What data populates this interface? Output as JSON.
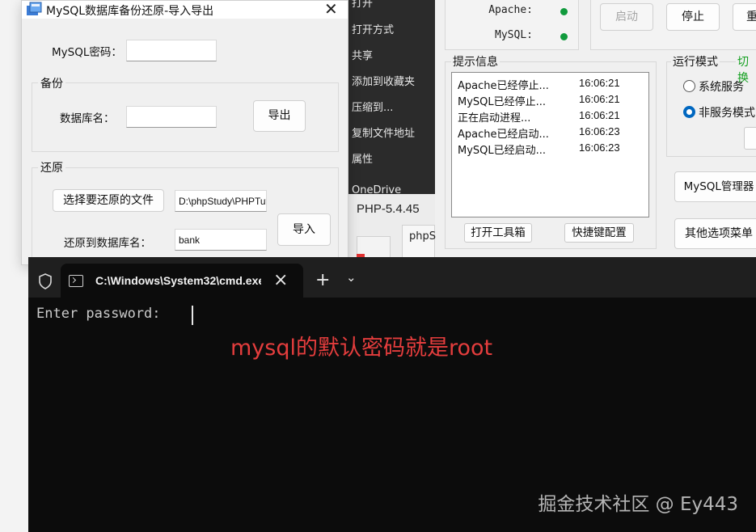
{
  "phpstudy": {
    "services": [
      {
        "name": "Apache:",
        "status": "running"
      },
      {
        "name": "MySQL:",
        "status": "running"
      }
    ],
    "start_label": "启动",
    "stop_label": "停止",
    "restart_label_partial": "重",
    "hint_group_label": "提示信息",
    "hints": [
      {
        "message": "Apache已经停止...",
        "time": "16:06:21"
      },
      {
        "message": "MySQL已经停止...",
        "time": "16:06:21"
      },
      {
        "message": "正在启动进程...",
        "time": "16:06:21"
      },
      {
        "message": "Apache已经启动...",
        "time": "16:06:23"
      },
      {
        "message": "MySQL已经启动...",
        "time": "16:06:23"
      }
    ],
    "toolbox_label": "打开工具箱",
    "hotkey_label": "快捷键配置",
    "mode_group_label": "运行模式",
    "mode_switch_partial": "切换",
    "mode_options": [
      "系统服务",
      "非服务模式"
    ],
    "mode_selected": 1,
    "mysql_manager_label": "MySQL管理器",
    "other_menu_label": "其他选项菜单",
    "status_colors": {
      "running": "#109a3c"
    }
  },
  "context_menu": {
    "items": [
      "打开",
      "打开方式",
      "共享",
      "添加到收藏夹",
      "压缩到...",
      "复制文件地址",
      "属性",
      "OneDrive"
    ]
  },
  "php_panel": {
    "version": "PHP-5.4.45",
    "tab_label": "phpS"
  },
  "dialog": {
    "title": "MySQL数据库备份还原-导入导出",
    "password_label": "MySQL密码：",
    "password_value": "",
    "backup_group": "备份",
    "db_name_label": "数据库名：",
    "db_name_value": "",
    "export_label": "导出",
    "restore_group": "还原",
    "choose_file_label": "选择要还原的文件",
    "file_path": "D:\\phpStudy\\PHPTutorial",
    "restore_to_label": "还原到数据库名：",
    "restore_db": "bank",
    "import_label": "导入"
  },
  "terminal": {
    "tab_title": "C:\\Windows\\System32\\cmd.exe",
    "prompt": "Enter password: ",
    "annotation": "mysql的默认密码就是root",
    "watermark": "掘金技术社区 @ Ey443"
  }
}
